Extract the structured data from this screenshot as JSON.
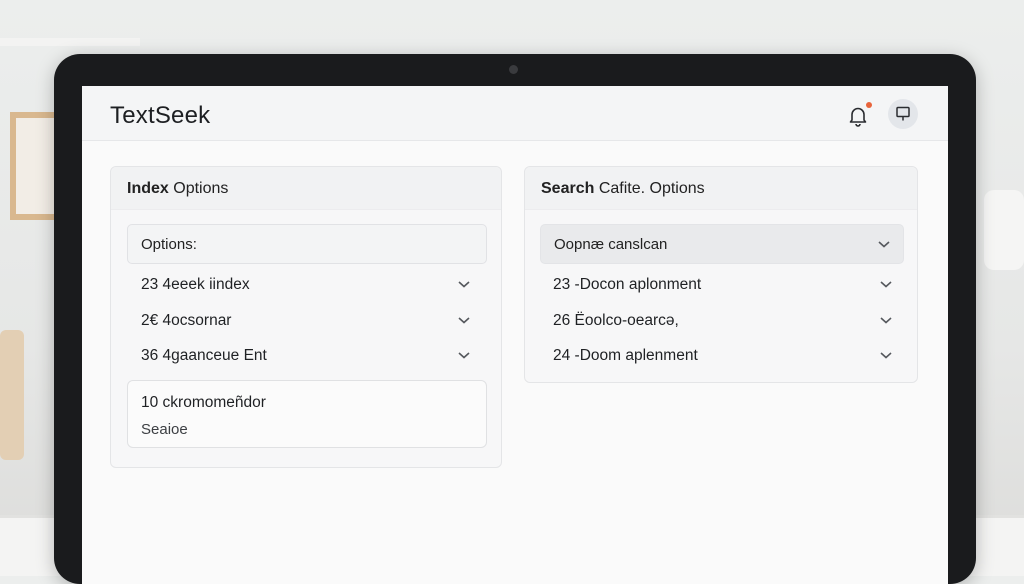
{
  "app": {
    "title": "TextSeek"
  },
  "header": {
    "notification_icon": "bell-icon",
    "device_icon": "device-icon",
    "accent_color": "#e8643b"
  },
  "index_panel": {
    "title_bold": "Index",
    "title_rest": " Options",
    "dropdown_label": "Options:",
    "rows": [
      {
        "label": "23 4eeek iindex"
      },
      {
        "label": "2€ 4ocsornar"
      },
      {
        "label": "36 4gaanceue Ent"
      }
    ],
    "card": {
      "title": "10 ckromomeñdor",
      "subtitle": "Seaioe"
    }
  },
  "search_panel": {
    "title_bold": "Search",
    "title_rest": " Cafite. Options",
    "dropdown_value": "Oopnæ canslcan",
    "rows": [
      {
        "label": "23 -Docon aplonment"
      },
      {
        "label": "26 Ëoolco-oearcə,"
      },
      {
        "label": "24 -Doom aplenment"
      }
    ]
  }
}
